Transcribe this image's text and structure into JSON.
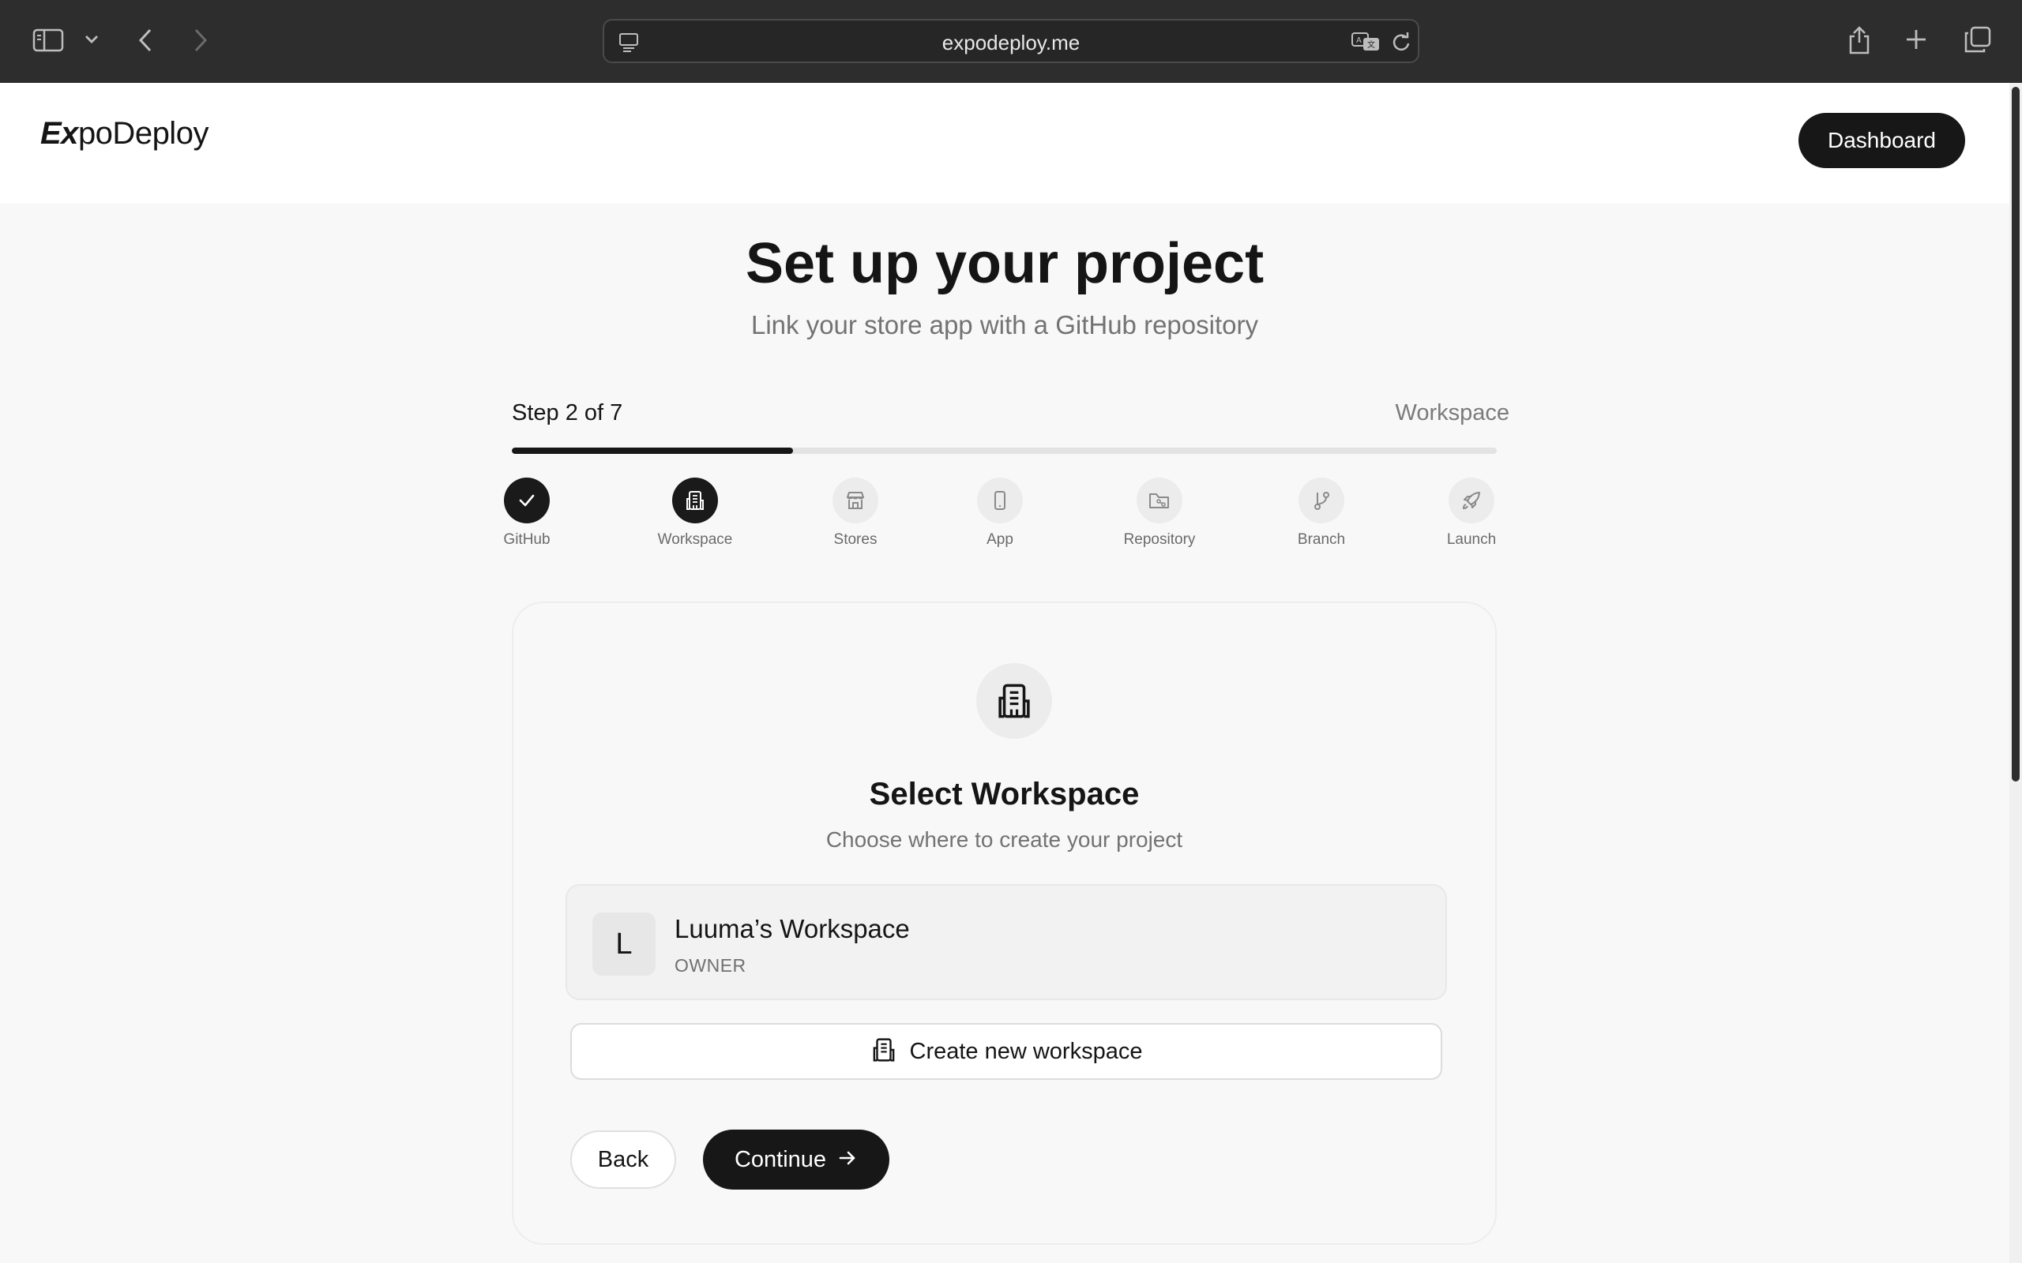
{
  "browser": {
    "url": "expodeploy.me",
    "icons": [
      "sidebar-icon",
      "chevron-down-icon",
      "back-arrow-icon",
      "forward-arrow-icon",
      "page-menu-icon",
      "translate-icon",
      "reload-icon",
      "share-icon",
      "new-tab-icon",
      "tabs-overview-icon"
    ]
  },
  "header": {
    "logo_ex": "Ex",
    "logo_rest": "poDeploy",
    "dashboard_label": "Dashboard"
  },
  "main": {
    "title": "Set up your project",
    "subtitle": "Link your store app with a GitHub repository"
  },
  "progress": {
    "step_label": "Step 2 of 7",
    "current_step_name": "Workspace",
    "fraction": 0.2857
  },
  "steps": [
    {
      "label": "GitHub",
      "icon": "check-icon",
      "state": "done"
    },
    {
      "label": "Workspace",
      "icon": "building-icon",
      "state": "active"
    },
    {
      "label": "Stores",
      "icon": "store-icon",
      "state": "pending"
    },
    {
      "label": "App",
      "icon": "phone-icon",
      "state": "pending"
    },
    {
      "label": "Repository",
      "icon": "folder-git-icon",
      "state": "pending"
    },
    {
      "label": "Branch",
      "icon": "git-branch-icon",
      "state": "pending"
    },
    {
      "label": "Launch",
      "icon": "rocket-icon",
      "state": "pending"
    }
  ],
  "card": {
    "icon": "building-icon",
    "title": "Select Workspace",
    "subtitle": "Choose where to create your project",
    "workspace": {
      "avatar_letter": "L",
      "name": "Luuma’s Workspace",
      "role": "OWNER"
    },
    "create_label": "Create new workspace",
    "back_label": "Back",
    "continue_label": "Continue"
  },
  "colors": {
    "accent_dark": "#171717",
    "page_bg": "#f8f8f8",
    "muted_text": "#737373"
  }
}
